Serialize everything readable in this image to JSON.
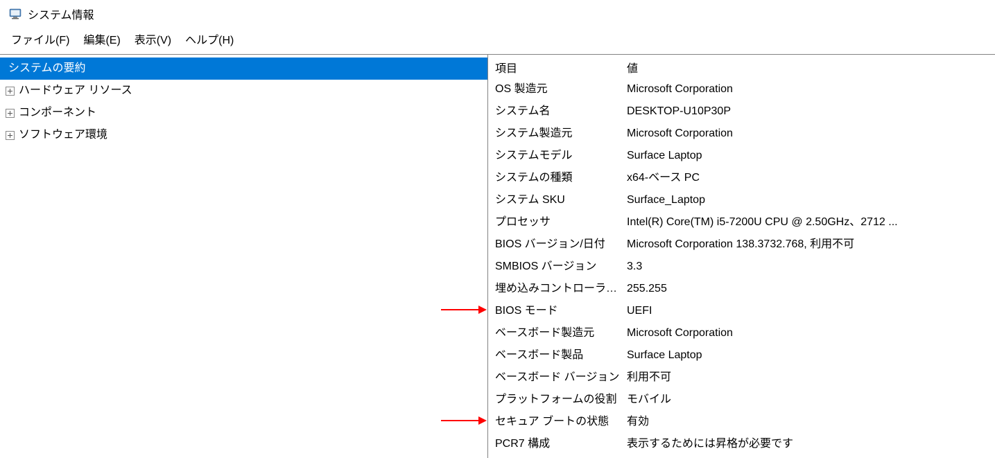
{
  "window": {
    "title": "システム情報"
  },
  "menu": {
    "file": "ファイル(F)",
    "edit": "編集(E)",
    "view": "表示(V)",
    "help": "ヘルプ(H)"
  },
  "tree": {
    "summary": "システムの要約",
    "hardware": "ハードウェア リソース",
    "components": "コンポーネント",
    "software": "ソフトウェア環境"
  },
  "table": {
    "header_name": "項目",
    "header_value": "値",
    "rows": [
      {
        "name": "OS 製造元",
        "value": "Microsoft Corporation"
      },
      {
        "name": "システム名",
        "value": "DESKTOP-U10P30P"
      },
      {
        "name": "システム製造元",
        "value": "Microsoft Corporation"
      },
      {
        "name": "システムモデル",
        "value": "Surface Laptop"
      },
      {
        "name": "システムの種類",
        "value": "x64-ベース PC"
      },
      {
        "name": "システム SKU",
        "value": "Surface_Laptop"
      },
      {
        "name": "プロセッサ",
        "value": "Intel(R) Core(TM) i5-7200U CPU @ 2.50GHz、2712 ..."
      },
      {
        "name": "BIOS バージョン/日付",
        "value": "Microsoft Corporation 138.3732.768, 利用不可"
      },
      {
        "name": "SMBIOS バージョン",
        "value": "3.3"
      },
      {
        "name": "埋め込みコントローラー...",
        "value": "255.255"
      },
      {
        "name": "BIOS モード",
        "value": "UEFI"
      },
      {
        "name": "ベースボード製造元",
        "value": "Microsoft Corporation"
      },
      {
        "name": "ベースボード製品",
        "value": "Surface Laptop"
      },
      {
        "name": "ベースボード バージョン",
        "value": "利用不可"
      },
      {
        "name": "プラットフォームの役割",
        "value": "モバイル"
      },
      {
        "name": "セキュア ブートの状態",
        "value": "有効"
      },
      {
        "name": "PCR7 構成",
        "value": "表示するためには昇格が必要です"
      }
    ]
  }
}
